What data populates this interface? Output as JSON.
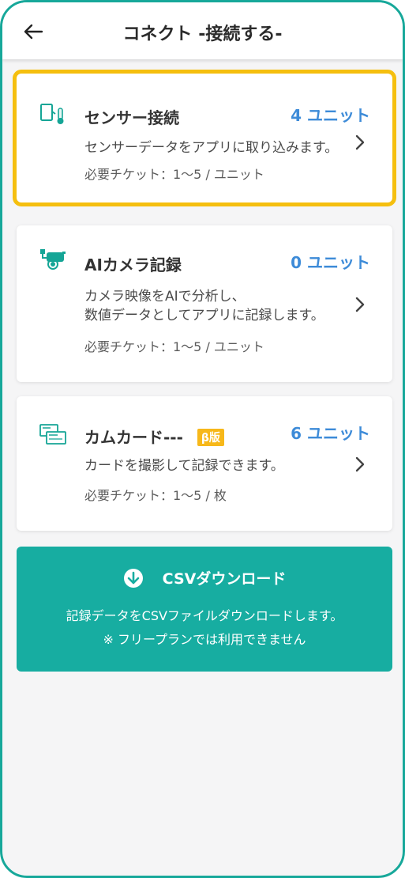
{
  "header": {
    "title": "コネクト -接続する-",
    "back_icon": "arrow-left-icon"
  },
  "cards": [
    {
      "name": "センサー接続",
      "count": "4 ユニット",
      "desc": "センサーデータをアプリに取り込みます。",
      "ticket": "必要チケット：1～5 / ユニット",
      "icon": "sensor-thermometer-icon",
      "selected": true
    },
    {
      "name": "AIカメラ記録",
      "count": "0 ユニット",
      "desc_line1": "カメラ映像をAIで分析し、",
      "desc_line2": "数値データとしてアプリに記録します。",
      "ticket": "必要チケット：1～5 / ユニット",
      "icon": "security-camera-icon"
    },
    {
      "name": "カムカード---",
      "badge": "β版",
      "count": "6 ユニット",
      "desc": "カードを撮影して記録できます。",
      "ticket": "必要チケット：1～5 / 枚",
      "icon": "business-card-icon"
    }
  ],
  "csv": {
    "title": "CSVダウンロード",
    "desc": "記録データをCSVファイルダウンロードします。",
    "note": "※ フリープランでは利用できません",
    "icon": "download-circle-icon"
  },
  "colors": {
    "accent": "#17ada1",
    "unit_count": "#3d8bd8",
    "selected_outline": "#f5bf0f",
    "beta_badge": "#f7b81a"
  }
}
